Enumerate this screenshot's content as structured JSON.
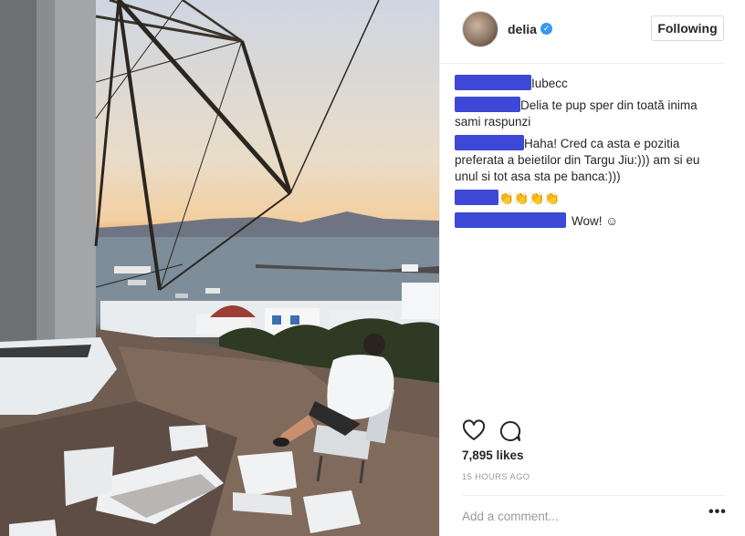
{
  "post": {
    "username": "delia",
    "verified_glyph": "✓",
    "follow_label": "Following",
    "photo_icon": "windmill-photo"
  },
  "comments": [
    {
      "text": "Iubecc"
    },
    {
      "text": "Delia te pup sper din toată inima sami raspunzi"
    },
    {
      "text": "Haha! Cred ca asta e pozitia preferata a beietilor din Targu Jiu:))) am si eu unul si tot asa sta pe banca:)))"
    },
    {
      "text": "👏👏👏👏"
    },
    {
      "text": "Wow! ☺"
    }
  ],
  "footer": {
    "likes": "7,895 likes",
    "time": "15 HOURS AGO",
    "comment_placeholder": "Add a comment...",
    "more_label": "•••"
  },
  "colors": {
    "redaction": "#3d49d6",
    "verified": "#3897f0"
  },
  "icons": {
    "like": "heart-icon",
    "comment": "comment-icon",
    "more": "more-options-icon"
  }
}
